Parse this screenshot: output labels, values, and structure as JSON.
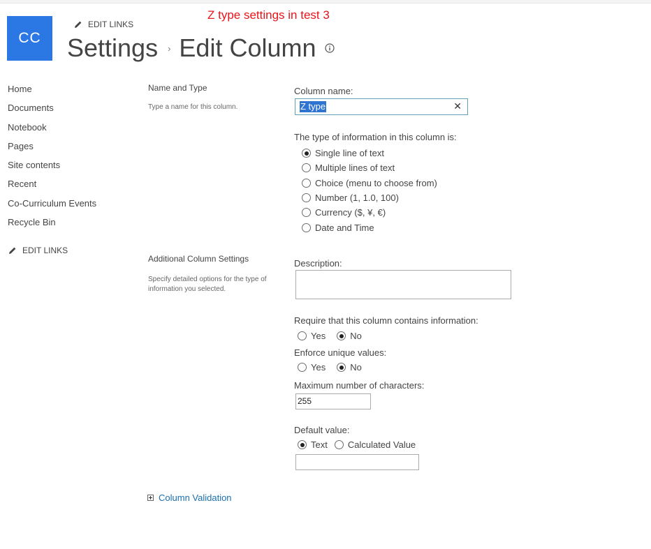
{
  "annotation": "Z type settings in test 3",
  "site_logo": "CC",
  "edit_links_label": "EDIT LINKS",
  "title": {
    "part1": "Settings",
    "separator": "›",
    "part2": "Edit Column"
  },
  "nav": [
    "Home",
    "Documents",
    "Notebook",
    "Pages",
    "Site contents",
    "Recent",
    "Co-Curriculum Events",
    "Recycle Bin"
  ],
  "name_section": {
    "title": "Name and Type",
    "description": "Type a name for this column.",
    "column_name_label": "Column name:",
    "column_name_value": "Z type",
    "type_label": "The type of information in this column is:",
    "types": [
      "Single line of text",
      "Multiple lines of text",
      "Choice (menu to choose from)",
      "Number (1, 1.0, 100)",
      "Currency ($, ¥, €)",
      "Date and Time"
    ],
    "selected_type": "Single line of text"
  },
  "additional_section": {
    "title": "Additional Column Settings",
    "description": "Specify detailed options for the type of information you selected.",
    "description_label": "Description:",
    "description_value": "",
    "require_label": "Require that this column contains information:",
    "require_yes": "Yes",
    "require_no": "No",
    "require_selected": "No",
    "unique_label": "Enforce unique values:",
    "unique_yes": "Yes",
    "unique_no": "No",
    "unique_selected": "No",
    "max_chars_label": "Maximum number of characters:",
    "max_chars_value": "255",
    "default_label": "Default value:",
    "default_text": "Text",
    "default_calculated": "Calculated Value",
    "default_selected": "Text",
    "default_value": ""
  },
  "column_validation": "Column Validation",
  "colors": {
    "logo_bg": "#2b78e4",
    "link": "#1a6fb0",
    "annotation": "#e8141a",
    "selection": "#2f74d0"
  }
}
